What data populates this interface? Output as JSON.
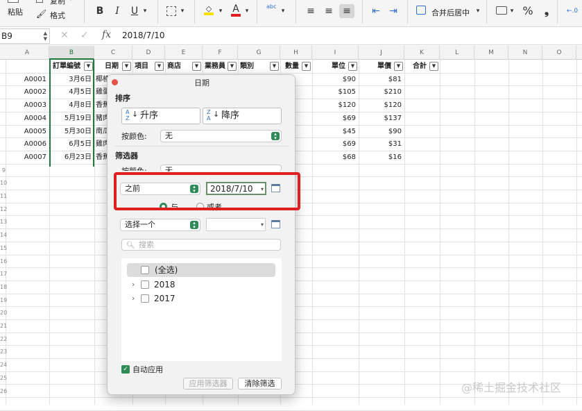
{
  "ribbon": {
    "paste": "粘贴",
    "copy": "复制",
    "format": "格式",
    "bold": "B",
    "italic": "I",
    "underline": "U",
    "wrap_glyph": "abc",
    "merge_center": "合并后居中",
    "percent": "%",
    "comma": "❟"
  },
  "formula_bar": {
    "name_box": "B9",
    "fx": "fx",
    "value": "2018/7/10"
  },
  "columns": [
    "A",
    "B",
    "C",
    "D",
    "E",
    "F",
    "G",
    "H",
    "I",
    "J",
    "K",
    "L",
    "M",
    "N",
    "O"
  ],
  "table": {
    "headers": [
      "訂單編號",
      "日期",
      "項目",
      "商店",
      "業務員",
      "類別",
      "數量",
      "單位",
      "單價",
      "合計"
    ],
    "rows": [
      {
        "id": "A0001",
        "date": "3月6日",
        "item": "椰楂",
        "price": "$90",
        "total": "$81"
      },
      {
        "id": "A0002",
        "date": "4月5日",
        "item": "雞蛋",
        "price": "$105",
        "total": "$210"
      },
      {
        "id": "A0003",
        "date": "4月8日",
        "item": "香蕉",
        "price": "$120",
        "total": "$120"
      },
      {
        "id": "A0004",
        "date": "5月19日",
        "item": "豬肉",
        "price": "$69",
        "total": "$137"
      },
      {
        "id": "A0005",
        "date": "5月30日",
        "item": "南瓜",
        "price": "$45",
        "total": "$90"
      },
      {
        "id": "A0006",
        "date": "6月5日",
        "item": "雞肉",
        "price": "$69",
        "total": "$31"
      },
      {
        "id": "A0007",
        "date": "6月23日",
        "item": "香蕉",
        "price": "$68",
        "total": "$16"
      }
    ],
    "row_numbers": [
      "9",
      "10",
      "11",
      "12",
      "13",
      "14",
      "15",
      "16",
      "17",
      "18",
      "19",
      "20",
      "21",
      "22",
      "23",
      "24",
      "25",
      "26"
    ]
  },
  "filter_popup": {
    "title": "日期",
    "sort_heading": "排序",
    "sort_asc": "升序",
    "sort_desc": "降序",
    "by_color_label": "按颜色:",
    "by_color_value": "无",
    "filter_heading": "筛选器",
    "filter_color_label": "按颜色:",
    "filter_color_value": "无",
    "condition1": "之前",
    "date1": "2018/7/10",
    "and_label": "与",
    "or_label": "或者",
    "condition2": "选择一个",
    "date2": "",
    "search_placeholder": "搜索",
    "list": [
      {
        "label": "(全选)"
      },
      {
        "label": "2018"
      },
      {
        "label": "2017"
      }
    ],
    "auto_apply": "自动应用",
    "apply_button": "应用筛选器",
    "clear_button": "清除筛选"
  },
  "watermark": "@稀土掘金技术社区"
}
